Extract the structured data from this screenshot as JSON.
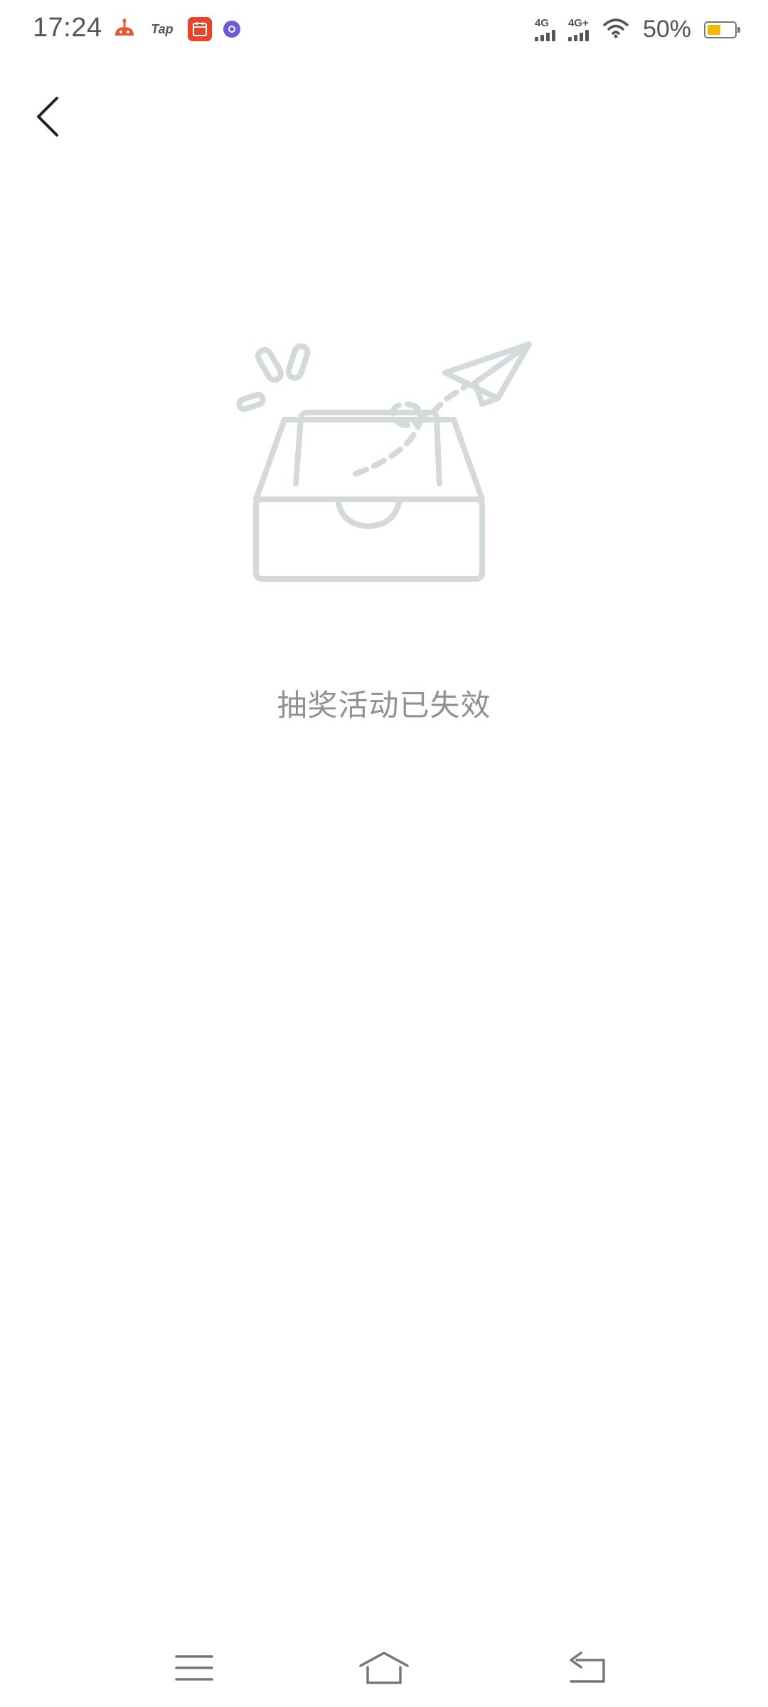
{
  "status_bar": {
    "time": "17:24",
    "notification_icons": [
      "robot-app-icon",
      "tap-app-icon",
      "calendar-app-icon",
      "badge-app-icon"
    ],
    "tap_label": "Tap",
    "signal_1_label": "4G",
    "signal_2_label": "4G+",
    "battery_percent": "50%",
    "battery_level": 0.5,
    "battery_color": "#f5b800"
  },
  "app_bar": {
    "back_icon": "chevron-left-icon"
  },
  "empty_state": {
    "illustration": "empty-inbox-tray-with-paper-plane",
    "message": "抽奖活动已失效",
    "illustration_color": "#d4d9dc",
    "message_color": "#8e9296"
  },
  "nav_bar": {
    "menu_icon": "menu-lines-icon",
    "home_icon": "home-icon",
    "back_icon": "return-arrow-icon"
  }
}
